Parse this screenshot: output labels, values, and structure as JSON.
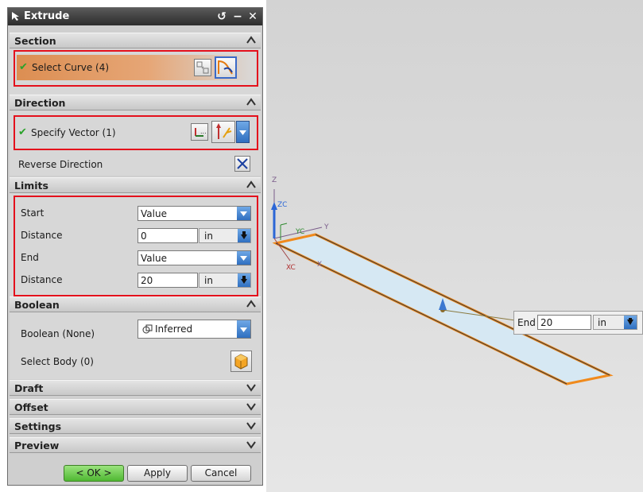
{
  "dialog": {
    "title": "Extrude",
    "section": {
      "header": "Section",
      "select_curve": "Select Curve (4)"
    },
    "direction": {
      "header": "Direction",
      "specify_vector": "Specify Vector (1)",
      "reverse_direction": "Reverse Direction"
    },
    "limits": {
      "header": "Limits",
      "start_label": "Start",
      "start_value": "Value",
      "distance1_label": "Distance",
      "distance1_value": "0",
      "distance1_unit": "in",
      "end_label": "End",
      "end_value": "Value",
      "distance2_label": "Distance",
      "distance2_value": "20",
      "distance2_unit": "in"
    },
    "boolean": {
      "header": "Boolean",
      "boolean_label": "Boolean (None)",
      "boolean_value": "Inferred",
      "select_body": "Select Body (0)"
    },
    "collapsed_groups": [
      "Draft",
      "Offset",
      "Settings",
      "Preview"
    ],
    "buttons": {
      "ok": "< OK >",
      "apply": "Apply",
      "cancel": "Cancel"
    }
  },
  "viewport": {
    "triad_labels": {
      "z": "Z",
      "zc": "ZC",
      "yc": "YC",
      "y": "Y",
      "xc": "XC",
      "x": "X"
    },
    "end_handle": {
      "label": "End",
      "value": "20",
      "unit": "in"
    }
  },
  "colors": {
    "highlight_box": "#e4101c",
    "edge_orange": "#f08a1c",
    "face_fill": "#cfe3f0",
    "dropdown_blue": "#2f6fc0",
    "ok_green": "#4fb832"
  }
}
